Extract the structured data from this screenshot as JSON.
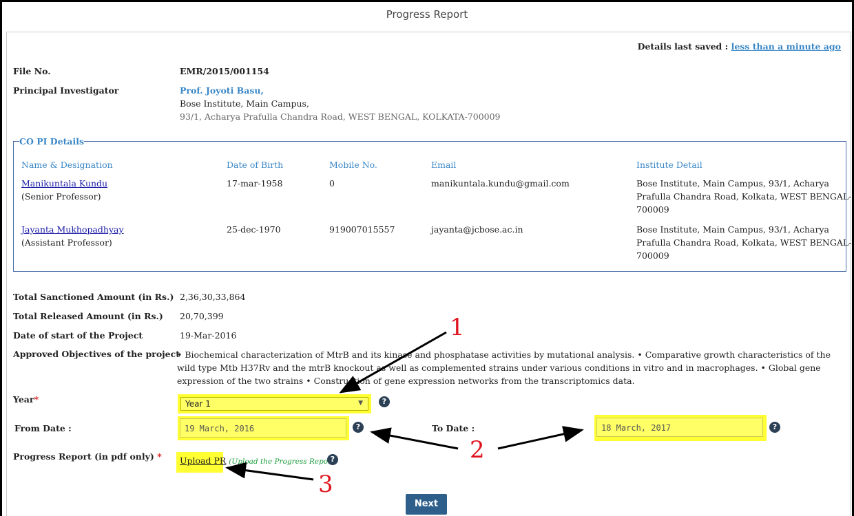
{
  "page_title": "Progress Report",
  "saved": {
    "label": "Details last saved :",
    "link": "less than a minute ago"
  },
  "file": {
    "label": "File No.",
    "value": "EMR/2015/001154"
  },
  "pi": {
    "label": "Principal Investigator",
    "name": "Prof. Joyoti Basu,",
    "institute": "Bose Institute, Main Campus,",
    "address": "93/1, Acharya Prafulla Chandra Road, WEST BENGAL, KOLKATA-700009"
  },
  "copi": {
    "legend": "CO PI Details",
    "headers": [
      "Name & Designation",
      "Date of Birth",
      "Mobile No.",
      "Email",
      "Institute Detail"
    ],
    "rows": [
      {
        "name": "Manikuntala Kundu",
        "designation": "(Senior Professor)",
        "dob": "17-mar-1958",
        "mobile": "0",
        "email": "manikuntala.kundu@gmail.com",
        "inst1": "Bose Institute, Main Campus, 93/1, Acharya",
        "inst2": "Prafulla Chandra Road, Kolkata, WEST BENGAL-",
        "inst3": "700009"
      },
      {
        "name": "Jayanta Mukhopadhyay",
        "designation": "(Assistant Professor)",
        "dob": "25-dec-1970",
        "mobile": "919007015557",
        "email": "jayanta@jcbose.ac.in",
        "inst1": "Bose Institute, Main Campus, 93/1, Acharya",
        "inst2": "Prafulla Chandra Road, Kolkata, WEST BENGAL-",
        "inst3": "700009"
      }
    ]
  },
  "sanctioned": {
    "label": "Total Sanctioned Amount (in Rs.)",
    "value": "2,36,30,33,864"
  },
  "released": {
    "label": "Total Released Amount (in Rs.)",
    "value": "20,70,399"
  },
  "start": {
    "label": "Date of start of the Project",
    "value": "19-Mar-2016"
  },
  "objectives": {
    "label": "Approved Objectives of the project",
    "value": "• Biochemical characterization of MtrB and its kinase and phosphatase activities by mutational analysis. • Comparative growth characteristics of the wild type Mtb H37Rv and the mtrB knockout as well as complemented strains under various conditions in vitro and in macrophages. • Global gene expression of the two strains • Construction of gene expression networks from the transcriptomics data."
  },
  "year": {
    "label": "Year",
    "required": "*",
    "selected": "Year  1"
  },
  "from_date": {
    "label": "From Date :",
    "value": "19 March, 2016"
  },
  "to_date": {
    "label": "To Date :",
    "value": "18 March, 2017"
  },
  "progress": {
    "label": "Progress Report (in pdf only)",
    "required": "*",
    "link": "Upload PR",
    "hint": "(Upload the Progress Report)"
  },
  "next_label": "Next",
  "help_glyph": "?",
  "annotations": {
    "n1": "1",
    "n2": "2",
    "n3": "3"
  },
  "colors": {
    "link": "#3a87c7",
    "highlight": "#ffff33",
    "button": "#2e5f8a",
    "annotation": "#e0141e"
  }
}
